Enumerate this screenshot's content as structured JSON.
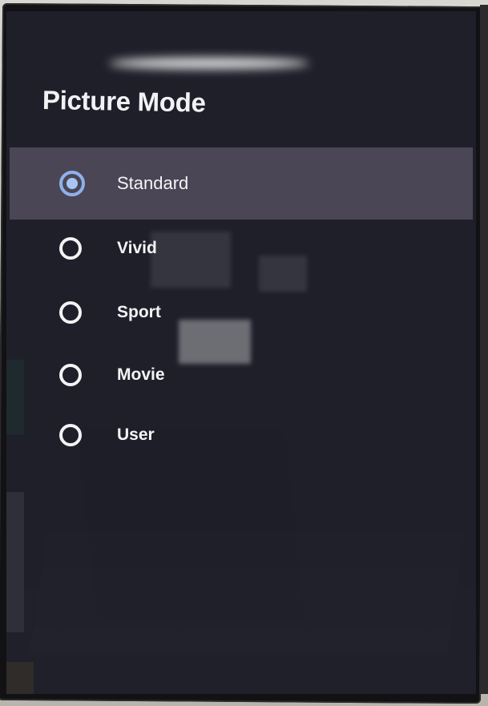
{
  "panel": {
    "title": "Picture Mode",
    "options": [
      {
        "label": "Standard",
        "selected": true
      },
      {
        "label": "Vivid",
        "selected": false
      },
      {
        "label": "Sport",
        "selected": false
      },
      {
        "label": "Movie",
        "selected": false
      },
      {
        "label": "User",
        "selected": false
      }
    ]
  },
  "colors": {
    "panel_bg": "#201f2a",
    "selected_row_bg": "#4b4656",
    "radio_selected": "#8fb1ea",
    "text": "#f4f4f6"
  }
}
